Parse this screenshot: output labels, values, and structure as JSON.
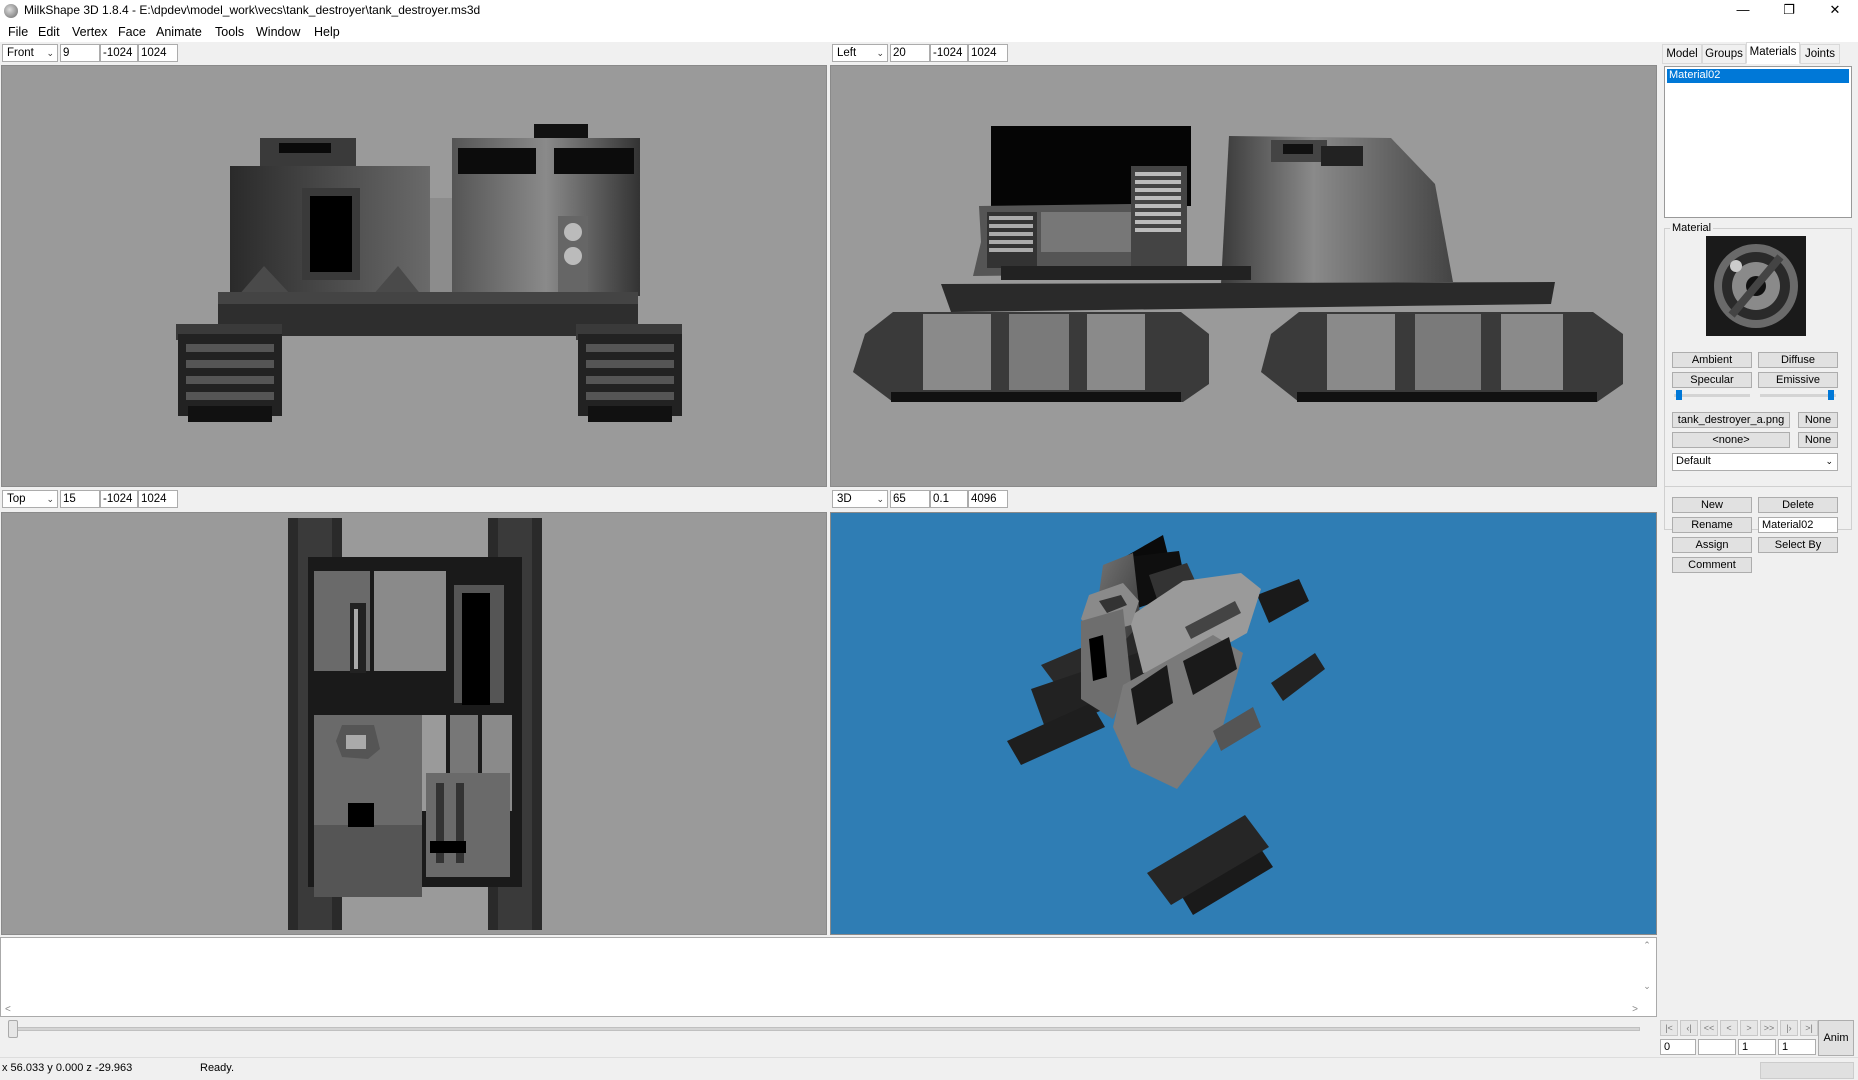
{
  "window": {
    "title": "MilkShape 3D 1.8.4 - E:\\dpdev\\model_work\\vecs\\tank_destroyer\\tank_destroyer.ms3d"
  },
  "menu": [
    "File",
    "Edit",
    "Vertex",
    "Face",
    "Animate",
    "Tools",
    "Window",
    "Help"
  ],
  "viewports": {
    "front": {
      "view": "Front",
      "v1": "9",
      "v2": "-1024",
      "v3": "1024"
    },
    "left": {
      "view": "Left",
      "v1": "20",
      "v2": "-1024",
      "v3": "1024"
    },
    "top": {
      "view": "Top",
      "v1": "15",
      "v2": "-1024",
      "v3": "1024"
    },
    "persp": {
      "view": "3D",
      "v1": "65",
      "v2": "0.1",
      "v3": "4096"
    }
  },
  "panel": {
    "tabs": [
      "Model",
      "Groups",
      "Materials",
      "Joints"
    ],
    "active_tab": "Materials",
    "materials": [
      "Material02"
    ],
    "material_label": "Material",
    "ambient": "Ambient",
    "diffuse": "Diffuse",
    "specular": "Specular",
    "emissive": "Emissive",
    "texture": "tank_destroyer_a.png",
    "none1": "None",
    "alpha": "<none>",
    "none2": "None",
    "mode": "Default",
    "new": "New",
    "delete": "Delete",
    "rename": "Rename",
    "name_value": "Material02",
    "assign": "Assign",
    "select_by": "Select By",
    "comment": "Comment"
  },
  "timeline": {
    "anim": "Anim",
    "f1": "0",
    "f2": "",
    "f3": "1",
    "f4": "1"
  },
  "status": {
    "coords": "x 56.033 y 0.000 z -29.963",
    "message": "Ready."
  },
  "colors": {
    "viewport_bg": "#9a9a9a",
    "persp_bg": "#2f7db4",
    "selection": "#0078d7"
  }
}
